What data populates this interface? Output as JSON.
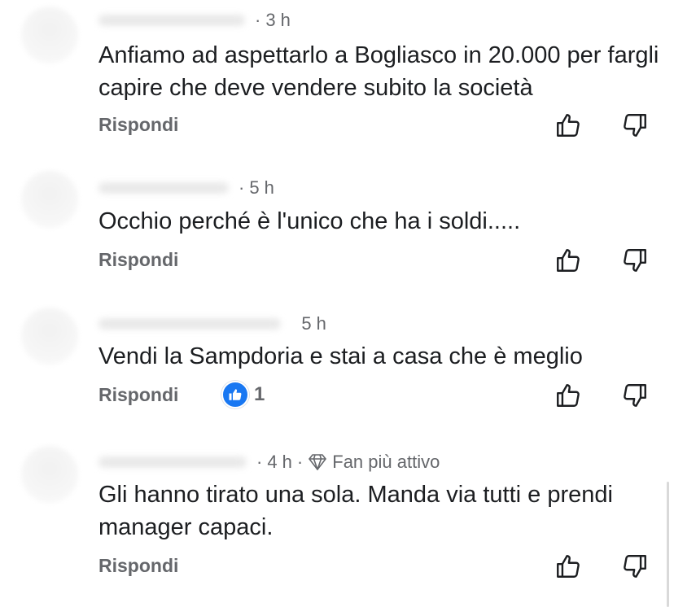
{
  "comments": [
    {
      "time": "3 h",
      "text": "Anfiamo ad aspettarlo a Bogliasco in 20.000 per fargli  capire che deve vendere subito la società",
      "reply_label": "Rispondi"
    },
    {
      "time": "5 h",
      "text": "Occhio perché è l'unico che ha i soldi.....",
      "reply_label": "Rispondi"
    },
    {
      "time": "5 h",
      "text": "Vendi la Sampdoria e stai a casa che è meglio",
      "reply_label": "Rispondi",
      "reaction_count": "1"
    },
    {
      "time": "4 h",
      "badge": "Fan più attivo",
      "text": "Gli hanno tirato una sola. Manda via tutti e prendi manager capaci.",
      "reply_label": "Rispondi"
    }
  ],
  "icons": {
    "like": "thumbs-up-outline-icon",
    "dislike": "thumbs-down-outline-icon",
    "reaction": "like-reaction-icon",
    "badge": "diamond-icon"
  },
  "colors": {
    "text": "#1c1e21",
    "secondary": "#65676b",
    "like_blue": "#1877f2"
  }
}
